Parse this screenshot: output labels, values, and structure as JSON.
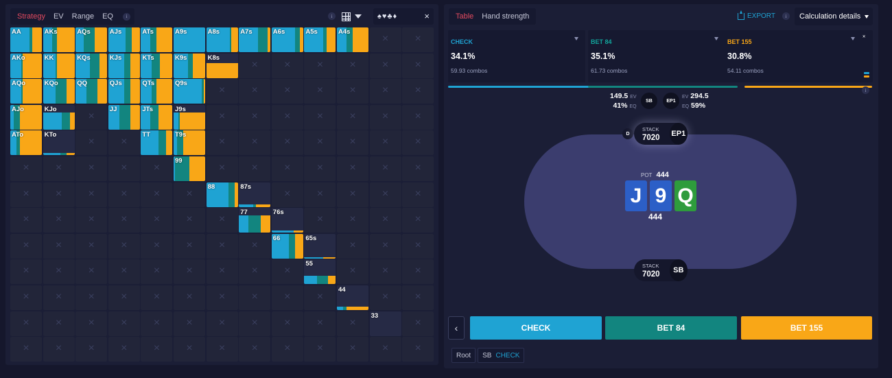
{
  "left": {
    "tabs": [
      "Strategy",
      "EV",
      "Range",
      "EQ"
    ],
    "active_tab": "Strategy",
    "info_icon": "i",
    "suit_icons": [
      "♠",
      "♥",
      "♣",
      "♦"
    ],
    "close": "×"
  },
  "colors": {
    "check": "#1fa3d3",
    "bet84": "#12857f",
    "bet155": "#f9a717"
  },
  "matrix": {
    "ranks": [
      "A",
      "K",
      "Q",
      "J",
      "T",
      "9",
      "8",
      "7",
      "6",
      "5",
      "4",
      "3",
      "2"
    ],
    "hands": [
      {
        "l": "AA",
        "r": 0,
        "c": 0,
        "f": [
          0.6,
          0.1,
          0.3
        ]
      },
      {
        "l": "AKs",
        "r": 0,
        "c": 1,
        "f": [
          0.3,
          0.15,
          0.55
        ]
      },
      {
        "l": "AQs",
        "r": 0,
        "c": 2,
        "f": [
          0.25,
          0.35,
          0.4
        ]
      },
      {
        "l": "AJs",
        "r": 0,
        "c": 3,
        "f": [
          0.55,
          0.2,
          0.25
        ]
      },
      {
        "l": "ATs",
        "r": 0,
        "c": 4,
        "f": [
          0.3,
          0.2,
          0.5
        ]
      },
      {
        "l": "A9s",
        "r": 0,
        "c": 5,
        "f": [
          1.0,
          0,
          0
        ]
      },
      {
        "l": "A8s",
        "r": 0,
        "c": 6,
        "f": [
          0.75,
          0.05,
          0.2
        ]
      },
      {
        "l": "A7s",
        "r": 0,
        "c": 7,
        "f": [
          0.6,
          0.3,
          0.1
        ]
      },
      {
        "l": "A6s",
        "r": 0,
        "c": 8,
        "f": [
          0.75,
          0.15,
          0.1
        ]
      },
      {
        "l": "A5s",
        "r": 0,
        "c": 9,
        "f": [
          0.6,
          0.1,
          0.3
        ]
      },
      {
        "l": "A4s",
        "r": 0,
        "c": 10,
        "f": [
          0.3,
          0.2,
          0.5
        ]
      },
      {
        "l": "AKo",
        "r": 1,
        "c": 0,
        "f": [
          0.35,
          0.05,
          0.6
        ]
      },
      {
        "l": "KK",
        "r": 1,
        "c": 1,
        "f": [
          0.4,
          0.05,
          0.55
        ]
      },
      {
        "l": "KQs",
        "r": 1,
        "c": 2,
        "f": [
          0.45,
          0.3,
          0.25
        ]
      },
      {
        "l": "KJs",
        "r": 1,
        "c": 3,
        "f": [
          0.5,
          0.2,
          0.3
        ]
      },
      {
        "l": "KTs",
        "r": 1,
        "c": 4,
        "f": [
          0.35,
          0.25,
          0.4
        ]
      },
      {
        "l": "K9s",
        "r": 1,
        "c": 5,
        "f": [
          0.45,
          0.15,
          0.4
        ]
      },
      {
        "l": "K8s",
        "r": 1,
        "c": 6,
        "f": [
          0,
          0,
          1.0
        ],
        "part": 0.6
      },
      {
        "l": "AQo",
        "r": 2,
        "c": 0,
        "f": [
          0.35,
          0.05,
          0.6
        ]
      },
      {
        "l": "KQo",
        "r": 2,
        "c": 1,
        "f": [
          0.4,
          0.35,
          0.25
        ]
      },
      {
        "l": "QQ",
        "r": 2,
        "c": 2,
        "f": [
          0.35,
          0.35,
          0.3
        ]
      },
      {
        "l": "QJs",
        "r": 2,
        "c": 3,
        "f": [
          0.5,
          0.2,
          0.3
        ]
      },
      {
        "l": "QTs",
        "r": 2,
        "c": 4,
        "f": [
          0.35,
          0.15,
          0.5
        ]
      },
      {
        "l": "Q9s",
        "r": 2,
        "c": 5,
        "f": [
          0.9,
          0.05,
          0.05
        ]
      },
      {
        "l": "AJo",
        "r": 3,
        "c": 0,
        "f": [
          0.1,
          0.2,
          0.7
        ]
      },
      {
        "l": "KJo",
        "r": 3,
        "c": 1,
        "f": [
          0.6,
          0.25,
          0.15
        ],
        "part": 0.7
      },
      {
        "l": "JJ",
        "r": 3,
        "c": 3,
        "f": [
          0.35,
          0.35,
          0.3
        ]
      },
      {
        "l": "JTs",
        "r": 3,
        "c": 4,
        "f": [
          0.3,
          0.25,
          0.45
        ]
      },
      {
        "l": "J9s",
        "r": 3,
        "c": 5,
        "f": [
          0.15,
          0.05,
          0.8
        ],
        "part": 0.7
      },
      {
        "l": "ATo",
        "r": 4,
        "c": 0,
        "f": [
          0.2,
          0.1,
          0.7
        ]
      },
      {
        "l": "KTo",
        "r": 4,
        "c": 1,
        "f": [
          0.55,
          0.2,
          0.25
        ],
        "part": 0.1
      },
      {
        "l": "TT",
        "r": 4,
        "c": 4,
        "f": [
          0.55,
          0.25,
          0.2
        ]
      },
      {
        "l": "T9s",
        "r": 4,
        "c": 5,
        "f": [
          0.1,
          0.2,
          0.7
        ]
      },
      {
        "l": "99",
        "r": 5,
        "c": 5,
        "f": [
          0.05,
          0.45,
          0.5
        ]
      },
      {
        "l": "88",
        "r": 6,
        "c": 6,
        "f": [
          0.7,
          0.2,
          0.1
        ]
      },
      {
        "l": "87s",
        "r": 6,
        "c": 7,
        "f": [
          0.45,
          0.1,
          0.45
        ],
        "part": 0.1
      },
      {
        "l": "77",
        "r": 7,
        "c": 7,
        "f": [
          0.3,
          0.4,
          0.3
        ],
        "part": 0.7
      },
      {
        "l": "76s",
        "r": 7,
        "c": 8,
        "f": [
          0.7,
          0,
          0.3
        ],
        "part": 0.1
      },
      {
        "l": "66",
        "r": 8,
        "c": 8,
        "f": [
          0.55,
          0.2,
          0.25
        ]
      },
      {
        "l": "65s",
        "r": 8,
        "c": 9,
        "f": [
          0.6,
          0,
          0.4
        ],
        "part": 0.05
      },
      {
        "l": "55",
        "r": 9,
        "c": 9,
        "f": [
          0.4,
          0.35,
          0.25
        ],
        "part": 0.35
      },
      {
        "l": "44",
        "r": 10,
        "c": 10,
        "f": [
          0.2,
          0.1,
          0.7
        ],
        "part": 0.15
      },
      {
        "l": "33",
        "r": 11,
        "c": 11,
        "f": [
          0,
          0,
          0
        ],
        "part": 0
      }
    ]
  },
  "right": {
    "tabs": [
      "Table",
      "Hand strength"
    ],
    "active_tab": "Table",
    "export": "EXPORT",
    "calc": "Calculation details",
    "actions": [
      {
        "name": "CHECK",
        "pct": "34.1%",
        "combos": "59.93 combos",
        "color": "#1fa3d3"
      },
      {
        "name": "BET 84",
        "pct": "35.1%",
        "combos": "61.73 combos",
        "color": "#12857f"
      },
      {
        "name": "BET 155",
        "pct": "30.8%",
        "combos": "54.11 combos",
        "color": "#f9a717"
      }
    ],
    "expand": "›‹",
    "sb_stats": {
      "ev": "149.5",
      "ev_label": "EV",
      "eq": "41%",
      "eq_label": "EQ",
      "badge": "SB"
    },
    "ep1_stats": {
      "ev": "294.5",
      "ev_label": "EV",
      "eq": "59%",
      "eq_label": "EQ",
      "badge": "EP1"
    },
    "seat_top": {
      "stack_label": "STACK",
      "stack": "7020",
      "pos": "EP1",
      "dealer": "D"
    },
    "seat_bottom": {
      "stack_label": "STACK",
      "stack": "7020",
      "pos": "SB"
    },
    "pot_label": "POT",
    "pot": "444",
    "board": [
      {
        "rank": "J",
        "color": "#2c5fc7"
      },
      {
        "rank": "9",
        "color": "#2c5fc7"
      },
      {
        "rank": "Q",
        "color": "#2e9c3c"
      }
    ],
    "board_total": "444",
    "prev": "‹",
    "buttons": [
      "CHECK",
      "BET 84",
      "BET 155"
    ],
    "crumbs": {
      "root": "Root",
      "pos": "SB",
      "action": "CHECK"
    }
  }
}
